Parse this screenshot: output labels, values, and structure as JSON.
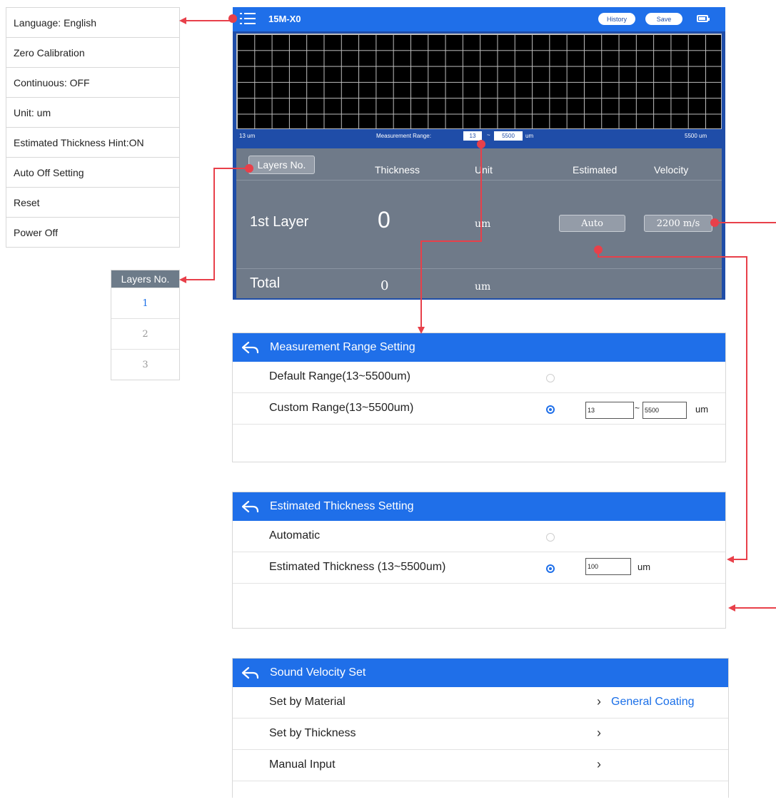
{
  "menu": {
    "items": [
      {
        "label": "Language: English"
      },
      {
        "label": "Zero Calibration"
      },
      {
        "label": "Continuous: OFF"
      },
      {
        "label": "Unit: um"
      },
      {
        "label": "Estimated Thickness Hint:ON"
      },
      {
        "label": "Auto Off Setting"
      },
      {
        "label": "Reset"
      },
      {
        "label": "Power Off"
      }
    ]
  },
  "layers_dropdown": {
    "header": "Layers No.",
    "options": [
      "1",
      "2",
      "3"
    ],
    "selected": "1"
  },
  "device": {
    "title": "15M-X0",
    "history_label": "History",
    "save_label": "Save",
    "range_bar": {
      "min_label": "13  um",
      "range_label": "Measurement Range:",
      "range_min": "13",
      "tilde": "~",
      "range_max": "5500",
      "unit": "um",
      "max_label": "5500  um"
    },
    "panel": {
      "layers_button": "Layers No.",
      "headers": {
        "thickness": "Thickness",
        "unit": "Unit",
        "estimated": "Estimated",
        "velocity": "Velocity"
      },
      "layer_row": {
        "name": "1st Layer",
        "value": "0",
        "unit": "um",
        "estimated": "Auto",
        "velocity": "2200 m/s"
      },
      "total_row": {
        "name": "Total",
        "value": "0",
        "unit": "um"
      }
    }
  },
  "measurement_range": {
    "title": "Measurement Range Setting",
    "default_label": "Default Range(13~5500um)",
    "custom_label": "Custom Range(13~5500um)",
    "custom_min": "13",
    "tilde": "~",
    "custom_max": "5500",
    "unit": "um",
    "selected": "custom"
  },
  "estimated_thickness": {
    "title": "Estimated Thickness Setting",
    "auto_label": "Automatic",
    "manual_label": "Estimated Thickness (13~5500um)",
    "value": "100",
    "unit": "um",
    "selected": "manual"
  },
  "sound_velocity": {
    "title": "Sound Velocity Set",
    "items": [
      {
        "label": "Set by Material",
        "value": "General Coating"
      },
      {
        "label": "Set by Thickness",
        "value": ""
      },
      {
        "label": "Manual Input",
        "value": ""
      }
    ]
  },
  "colors": {
    "accent": "#1f6fe9",
    "arrow": "#e8404a",
    "panel": "#6f7a89",
    "link": "#1a6fe8"
  }
}
